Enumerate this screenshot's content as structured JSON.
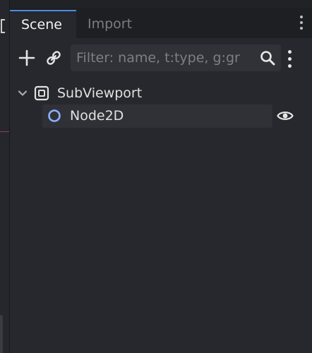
{
  "tabs": [
    {
      "label": "Scene",
      "active": true
    },
    {
      "label": "Import",
      "active": false
    }
  ],
  "toolbar": {
    "add_icon": "plus-icon",
    "link_icon": "link-icon",
    "filter": {
      "value": "",
      "placeholder": "Filter: name, t:type, g:gr"
    },
    "search_icon": "search-icon",
    "menu_icon": "kebab-menu-icon"
  },
  "tree": {
    "root": {
      "label": "SubViewport",
      "icon": "subviewport-icon",
      "expanded": true
    },
    "children": [
      {
        "label": "Node2D",
        "icon": "node2d-icon",
        "visible": true
      }
    ]
  },
  "colors": {
    "accent": "#4d8ae0",
    "node2d": "#8eb0ff",
    "panel": "#26282d"
  }
}
